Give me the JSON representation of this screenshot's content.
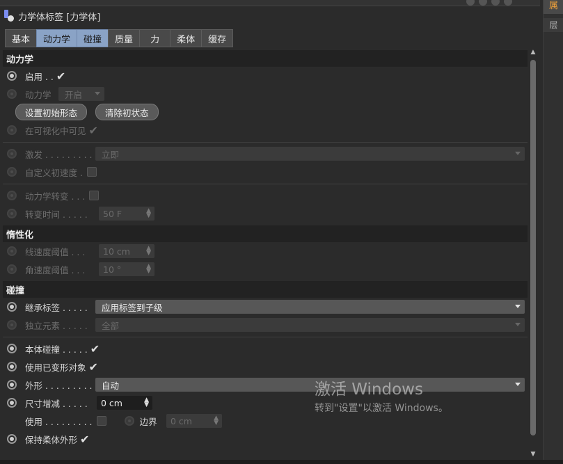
{
  "title": "力学体标签 [力学体]",
  "tabs": [
    "基本",
    "动力学",
    "碰撞",
    "质量",
    "力",
    "柔体",
    "缓存"
  ],
  "sections": {
    "dynamics": "动力学",
    "inertia": "惰性化",
    "collision": "碰撞"
  },
  "dynamics": {
    "enabled_label": "启用 . .",
    "dynamic_label": "动力学",
    "dynamic_value": "开启",
    "set_initial_btn": "设置初始形态",
    "clear_initial_btn": "清除初状态",
    "visible_label": "在可视化中可见",
    "trigger_label": "激发 . . . . . . . . .",
    "trigger_value": "立即",
    "custom_velocity_label": "自定义初速度 .",
    "transition_label": "动力学转变 . . .",
    "transition_time_label": "转变时间 . . . . .",
    "transition_time_value": "50 F"
  },
  "inertia": {
    "linear_label": "线速度阈值 . . .",
    "linear_value": "10 cm",
    "angular_label": "角速度阈值 . . .",
    "angular_value": "10 °"
  },
  "collision": {
    "inherit_label": "继承标签 . . . . .",
    "inherit_value": "应用标签到子级",
    "individual_label": "独立元素 . . . . .",
    "individual_value": "全部",
    "self_collision_label": "本体碰撞 . . . . .",
    "use_deformed_label": "使用已变形对象",
    "shape_label": "外形 . . . . . . . . .",
    "shape_value": "自动",
    "size_label": "尺寸增减 . . . . .",
    "size_value": "0 cm",
    "use_label": "使用 . . . . . . . . .",
    "margin_label": "边界",
    "margin_value": "0 cm",
    "keep_soft_label": "保持柔体外形"
  },
  "right_tabs": [
    "属",
    "层"
  ],
  "watermark": {
    "line1": "激活 Windows",
    "line2": "转到\"设置\"以激活 Windows。"
  }
}
